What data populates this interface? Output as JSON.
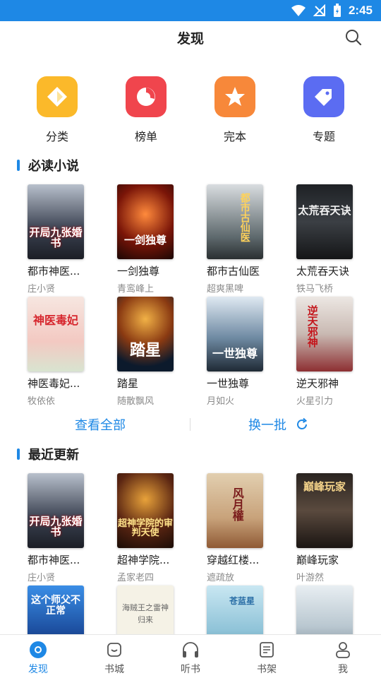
{
  "status_bar": {
    "time": "2:45"
  },
  "header": {
    "title": "发现"
  },
  "categories": [
    {
      "label": "分类",
      "icon": "category-icon",
      "color": "#fbb92a"
    },
    {
      "label": "榜单",
      "icon": "ranking-icon",
      "color": "#f0454d"
    },
    {
      "label": "完本",
      "icon": "star-icon",
      "color": "#f7883a"
    },
    {
      "label": "专题",
      "icon": "tag-icon",
      "color": "#5b6cf2"
    }
  ],
  "must_read": {
    "title": "必读小说",
    "books": [
      {
        "title": "都市神医...",
        "author": "庄小贤",
        "cover_text": "开局九张婚书"
      },
      {
        "title": "一剑独尊",
        "author": "青鸾峰上",
        "cover_text": "一剑独尊"
      },
      {
        "title": "都市古仙医",
        "author": "超爽黑啤",
        "cover_text": "都市古仙医"
      },
      {
        "title": "太荒吞天诀",
        "author": "铁马飞桥",
        "cover_text": "太荒吞天诀"
      },
      {
        "title": "神医毒妃...",
        "author": "牧依依",
        "cover_text": "神医毒妃"
      },
      {
        "title": "踏星",
        "author": "随散飘风",
        "cover_text": "踏星"
      },
      {
        "title": "一世独尊",
        "author": "月如火",
        "cover_text": "一世独尊"
      },
      {
        "title": "逆天邪神",
        "author": "火星引力",
        "cover_text": "逆天邪神"
      }
    ]
  },
  "actions": {
    "view_all": "查看全部",
    "refresh": "换一批"
  },
  "recent": {
    "title": "最近更新",
    "books": [
      {
        "title": "都市神医...",
        "author": "庄小贤",
        "cover_text": "开局九张婚书"
      },
      {
        "title": "超神学院...",
        "author": "孟家老四",
        "cover_text": "超神学院的审判天使"
      },
      {
        "title": "穿越红楼...",
        "author": "遮疏放",
        "cover_text": "风月權"
      },
      {
        "title": "巅峰玩家",
        "author": "叶游然",
        "cover_text": "巅峰玩家"
      },
      {
        "title": "",
        "author": "",
        "cover_text": "这个师父不正常"
      },
      {
        "title": "",
        "author": "",
        "cover_text": "海贼王之雷神归来"
      },
      {
        "title": "",
        "author": "",
        "cover_text": "苍蓝星"
      },
      {
        "title": "",
        "author": "",
        "cover_text": ""
      }
    ]
  },
  "bottom_nav": [
    {
      "label": "发现",
      "icon": "discover-icon",
      "active": true
    },
    {
      "label": "书城",
      "icon": "bookstore-icon"
    },
    {
      "label": "听书",
      "icon": "headphones-icon"
    },
    {
      "label": "书架",
      "icon": "bookshelf-icon"
    },
    {
      "label": "我",
      "icon": "profile-icon"
    }
  ],
  "colors": {
    "accent": "#1e88e5",
    "muted": "#8a8a8a"
  }
}
